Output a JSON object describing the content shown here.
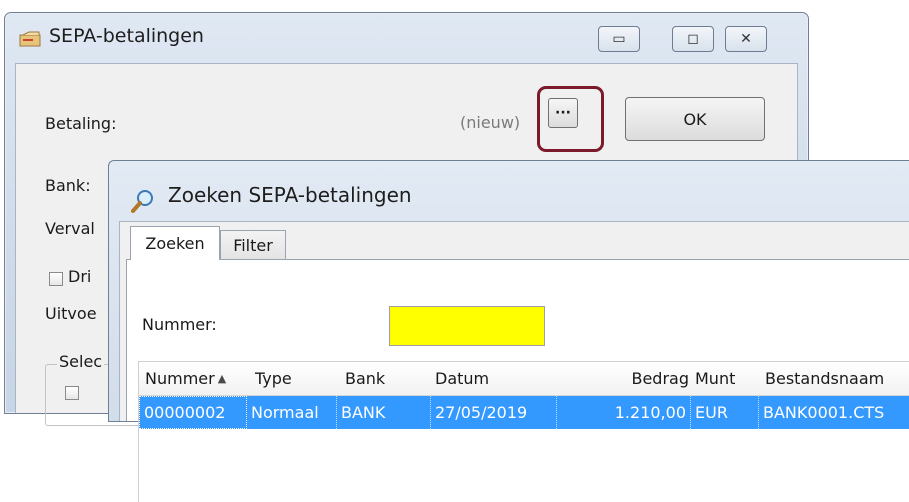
{
  "main_window": {
    "title": "SEPA-betalingen",
    "minimize_glyph": "▭",
    "maximize_glyph": "◻",
    "close_glyph": "✕",
    "betaling_label": "Betaling:",
    "betaling_value": "(nieuw)",
    "browse_button": "···",
    "ok_button": "OK",
    "bank_label": "Bank:",
    "verval_label": "Verval",
    "dri_label": "Dri",
    "uitvoe_label": "Uitvoe",
    "selec_label": "Selec"
  },
  "search_window": {
    "title": "Zoeken SEPA-betalingen",
    "tabs": [
      {
        "label": "Zoeken",
        "active": true
      },
      {
        "label": "Filter",
        "active": false
      }
    ],
    "nummer_label": "Nummer:",
    "nummer_value": "",
    "columns": [
      "Nummer",
      "Type",
      "Bank",
      "Datum",
      "Bedrag",
      "Munt",
      "Bestandsnaam"
    ],
    "sort_glyph": "▲",
    "rows": [
      {
        "Nummer": "00000002",
        "Type": "Normaal",
        "Bank": "BANK",
        "Datum": "27/05/2019",
        "Bedrag": "1.210,00",
        "Munt": "EUR",
        "Bestandsnaam": "BANK0001.CTS",
        "selected": true
      }
    ]
  },
  "colors": {
    "highlight_ring": "#7b1a2a",
    "selected_row": "#3399ff",
    "nummer_input_bg": "#ffff00"
  }
}
